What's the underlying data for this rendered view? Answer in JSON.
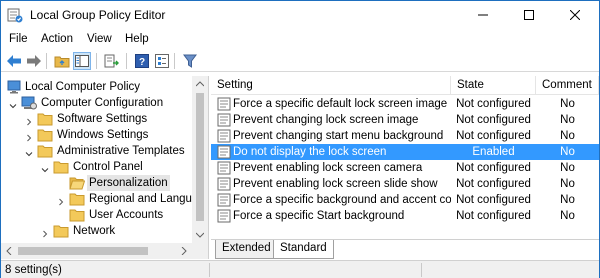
{
  "window": {
    "title": "Local Group Policy Editor"
  },
  "menubar": {
    "items": [
      "File",
      "Action",
      "View",
      "Help"
    ]
  },
  "toolbar": {
    "buttons": [
      "back-arrow-icon",
      "forward-arrow-icon",
      "up-folder-icon",
      "show-hide-tree-icon",
      "export-list-icon",
      "help-icon",
      "properties-icon",
      "filter-icon"
    ]
  },
  "tree": {
    "items": [
      {
        "label": "Local Computer Policy",
        "icon": "computer-icon"
      },
      {
        "label": "Computer Configuration",
        "icon": "computer-config-icon"
      },
      {
        "label": "Software Settings",
        "icon": "folder-icon"
      },
      {
        "label": "Windows Settings",
        "icon": "folder-icon"
      },
      {
        "label": "Administrative Templates",
        "icon": "folder-icon"
      },
      {
        "label": "Control Panel",
        "icon": "folder-icon"
      },
      {
        "label": "Personalization",
        "icon": "folder-open-icon"
      },
      {
        "label": "Regional and Langua",
        "icon": "folder-icon"
      },
      {
        "label": "User Accounts",
        "icon": "folder-icon"
      },
      {
        "label": "Network",
        "icon": "folder-icon"
      }
    ]
  },
  "list": {
    "columns": [
      "Setting",
      "State",
      "Comment"
    ],
    "rows": [
      {
        "setting": "Force a specific default lock screen image",
        "state": "Not configured",
        "comment": "No"
      },
      {
        "setting": "Prevent changing lock screen image",
        "state": "Not configured",
        "comment": "No"
      },
      {
        "setting": "Prevent changing start menu background",
        "state": "Not configured",
        "comment": "No"
      },
      {
        "setting": "Do not display the lock screen",
        "state": "Enabled",
        "comment": "No"
      },
      {
        "setting": "Prevent enabling lock screen camera",
        "state": "Not configured",
        "comment": "No"
      },
      {
        "setting": "Prevent enabling lock screen slide show",
        "state": "Not configured",
        "comment": "No"
      },
      {
        "setting": "Force a specific background and accent color",
        "state": "Not configured",
        "comment": "No"
      },
      {
        "setting": "Force a specific Start background",
        "state": "Not configured",
        "comment": "No"
      }
    ],
    "selected_index": 3
  },
  "tabs": {
    "items": [
      "Extended",
      "Standard"
    ],
    "active": "Standard"
  },
  "status": {
    "text": "8 setting(s)"
  },
  "colors": {
    "selection": "#3399ff",
    "window_border": "#1e6fbf",
    "tree_selection": "#e5e5e5"
  }
}
